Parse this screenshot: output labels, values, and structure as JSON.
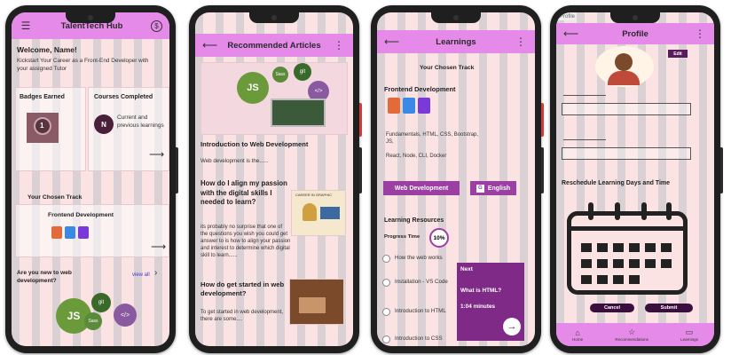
{
  "phone1": {
    "app_title": "TalentTech Hub",
    "welcome": "Welcome, Name!",
    "subtitle": "Kickstart Your Career as a Front-End Developer with your assigned Tutor",
    "badges_label": "Badges Earned",
    "courses_label": "Courses Completed",
    "courses_avatar": "N",
    "courses_desc": "Current and previous learnings",
    "track_label": "Your Chosen Track",
    "track_name": "Frontend Development",
    "new_q": "Are you new to web development?",
    "view_all": "view all",
    "icons": [
      "menu-icon",
      "dollar-icon",
      "badge-icon",
      "arrow-right-icon"
    ]
  },
  "phone2": {
    "title": "Recommended Articles",
    "tech_labels": [
      "JS",
      "Sass",
      "git",
      "</>"
    ],
    "a1_title": "Introduction to Web Development",
    "a1_text": "Web development is the......",
    "a2_title": "How do I align my passion with the digital skills I needed to learn?",
    "a2_text": "its probably no surprise that one of the questions you wish you could get answer to is how to align your passion and interest to determine which digital skill to learn......",
    "a2_img_label": "CAREER IN GRAPHIC",
    "a3_title": "How do get started in web development?",
    "a3_text": "To get started in web development, there are some...."
  },
  "phone3": {
    "title": "Learnings",
    "chosen": "Your Chosen Track",
    "track": "Frontend Development",
    "skills1": "Fundamentals, HTML, CSS, Bootstrap, JS,",
    "skills2": "React, Node, CLI, Docker",
    "btn_webdev": "Web Development",
    "btn_lang": "English",
    "resources": "Learning Resources",
    "progress_label": "Progress Time",
    "progress_value": "10%",
    "progress": 0.1,
    "items": [
      "How the web works",
      "Installation - VS Code",
      "Introduction to HTML",
      "Introduction to CSS"
    ],
    "next_label": "Next",
    "next_title": "What is HTML?",
    "next_time": "1:04 minutes"
  },
  "phone4": {
    "corner_label": "Profile",
    "title": "Profile",
    "edit": "Edit",
    "reschedule": "Reschedule Learning Days and Time",
    "cancel": "Cancel",
    "submit": "Submit",
    "nav": [
      "Home",
      "Recommendations",
      "Learnings"
    ]
  },
  "colors": {
    "accent": "#e58ae8",
    "purple": "#9b3fa3",
    "deep": "#5a1a5e",
    "screen_bg": "#fbe3e3"
  }
}
